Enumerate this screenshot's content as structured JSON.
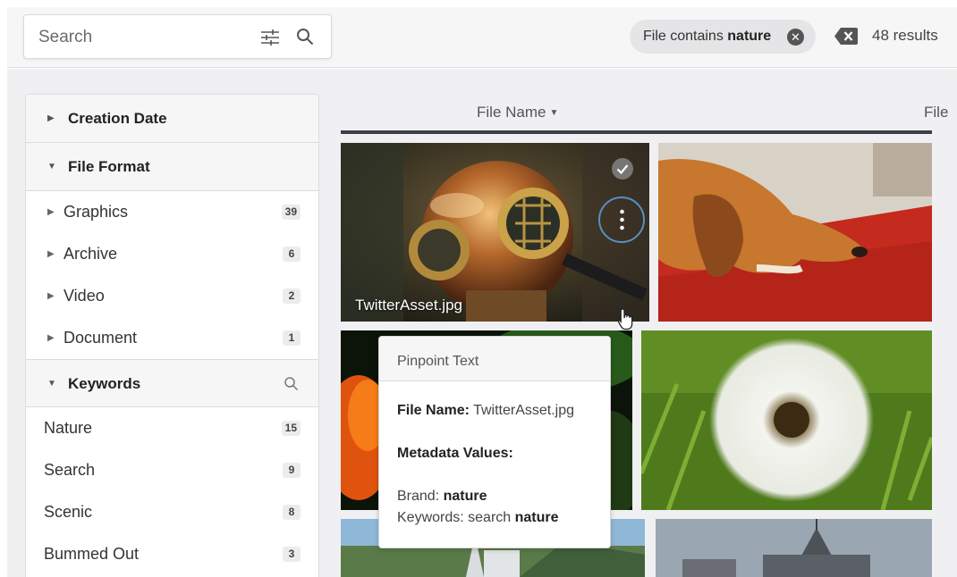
{
  "search": {
    "placeholder": "Search"
  },
  "filter_chip": {
    "prefix": "File contains",
    "term": "nature",
    "remove_icon": "x-circle-icon"
  },
  "results": {
    "count_label": "48 results",
    "clear_icon": "backspace-icon"
  },
  "sidebar": {
    "sections": [
      {
        "title": "Creation Date",
        "expanded": false
      },
      {
        "title": "File Format",
        "expanded": true,
        "items": [
          {
            "label": "Graphics",
            "count": "39"
          },
          {
            "label": "Archive",
            "count": "6"
          },
          {
            "label": "Video",
            "count": "2"
          },
          {
            "label": "Document",
            "count": "1"
          }
        ]
      },
      {
        "title": "Keywords",
        "expanded": true,
        "search_icon": "search-icon",
        "items": [
          {
            "label": "Nature",
            "count": "15"
          },
          {
            "label": "Search",
            "count": "9"
          },
          {
            "label": "Scenic",
            "count": "8"
          },
          {
            "label": "Bummed Out",
            "count": "3"
          }
        ]
      }
    ]
  },
  "grid": {
    "columns": [
      {
        "label": "File Name",
        "sort_icon": "caret-down-icon"
      },
      {
        "label": "File"
      }
    ],
    "first_asset_name": "TwitterAsset.jpg"
  },
  "tooltip": {
    "title": "Pinpoint Text",
    "file_label": "File Name:",
    "file_value": "TwitterAsset.jpg",
    "metadata_title": "Metadata Values:",
    "brand_label": "Brand:",
    "brand_value": "nature",
    "keywords_label": "Keywords: search",
    "keywords_value": "nature"
  },
  "colors": {
    "accent": "#5b8fc2",
    "header_line": "#3a3f48",
    "chip_bg": "#e5e5e7"
  }
}
